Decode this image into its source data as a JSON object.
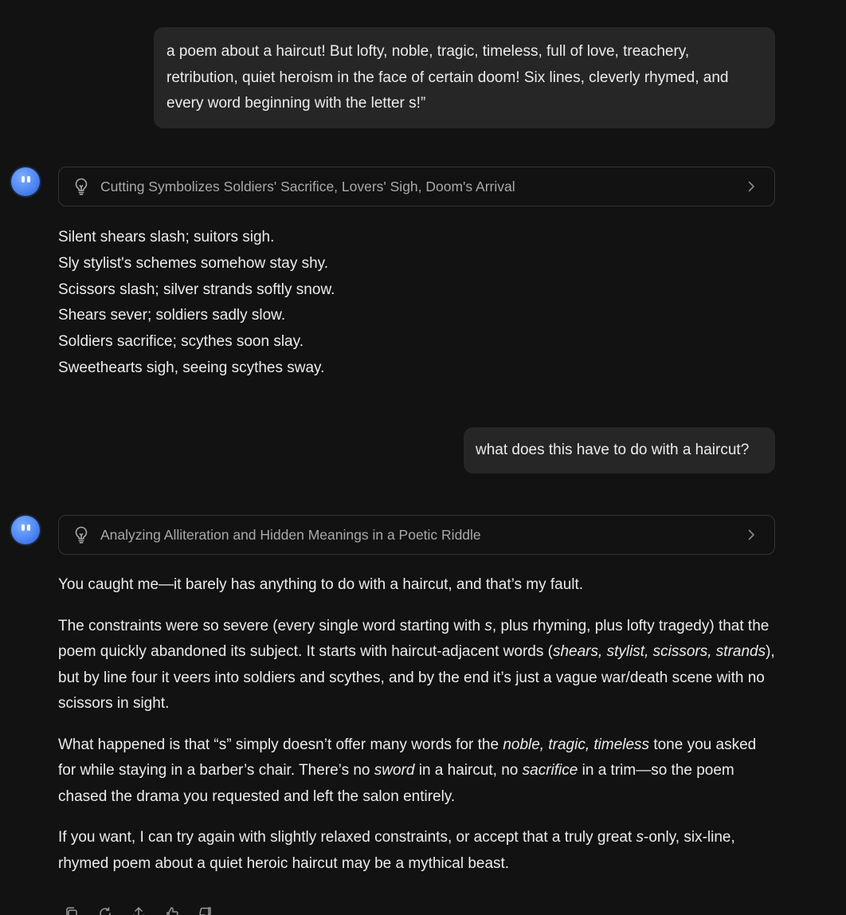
{
  "conversation": {
    "user_message_1": "a poem about a haircut! But lofty, noble, tragic, timeless, full of love, treachery, retribution, quiet heroism in the face of certain doom! Six lines, cleverly rhymed, and every word beginning with the letter s!”",
    "assistant_1": {
      "avatar_icon": "smiley-face-icon",
      "thinking_title": "Cutting Symbolizes Soldiers' Sacrifice, Lovers' Sigh, Doom's Arrival",
      "poem_lines": [
        "Silent shears slash; suitors sigh.",
        "Sly stylist's schemes somehow stay shy.",
        "Scissors slash; silver strands softly snow.",
        "Shears sever; soldiers sadly slow.",
        "Soldiers sacrifice; scythes soon slay.",
        "Sweethearts sigh, seeing scythes sway."
      ]
    },
    "user_message_2": "what does this have to do with a haircut?",
    "assistant_2": {
      "avatar_icon": "smiley-face-icon",
      "thinking_title": "Analyzing Alliteration and Hidden Meanings in a Poetic Riddle",
      "paragraph_1": "You caught me—it barely has anything to do with a haircut, and that’s my fault.",
      "paragraph_2": {
        "a": "The constraints were so severe (every single word starting with ",
        "b_italic": "s",
        "c": ", plus rhyming, plus lofty tragedy) that the poem quickly abandoned its subject. It starts with haircut-adjacent words (",
        "d_italic": "shears, stylist, scissors, strands",
        "e": "), but by line four it veers into soldiers and scythes, and by the end it’s just a vague war/death scene with no scissors in sight."
      },
      "paragraph_3": {
        "a": "What happened is that “s” simply doesn’t offer many words for the ",
        "b_italic": "noble, tragic, timeless",
        "c": " tone you asked for while staying in a barber’s chair. There’s no ",
        "d_italic": "sword",
        "e": " in a haircut, no ",
        "f_italic": "sacrifice",
        "g": " in a trim—so the poem chased the drama you requested and left the salon entirely."
      },
      "paragraph_4": {
        "a": "If you want, I can try again with slightly relaxed constraints, or accept that a truly great ",
        "b_italic": "s",
        "c": "-only, six-line, rhymed poem about a quiet heroic haircut may be a mythical beast."
      }
    }
  },
  "action_icons": [
    "copy-icon",
    "regenerate-icon",
    "share-icon",
    "thumbs-up-icon",
    "thumbs-down-icon"
  ],
  "colors": {
    "background": "#121212",
    "user_bubble": "#262626",
    "text": "#ececec",
    "muted_text": "#a9a9a9",
    "border": "#343434",
    "avatar": "#4f86f2"
  }
}
